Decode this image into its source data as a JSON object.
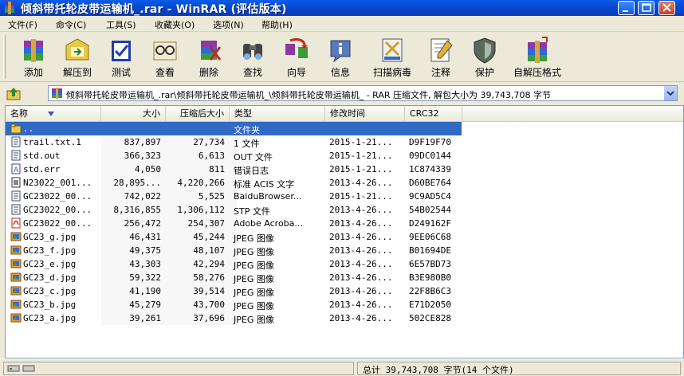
{
  "window": {
    "title": "倾斜带托轮皮带运输机_.rar - WinRAR (评估版本)"
  },
  "menu": [
    "文件(F)",
    "命令(C)",
    "工具(S)",
    "收藏夹(O)",
    "选项(N)",
    "帮助(H)"
  ],
  "toolbar": [
    {
      "label": "添加",
      "icon": "add-archive-icon"
    },
    {
      "label": "解压到",
      "icon": "extract-to-icon"
    },
    {
      "label": "测试",
      "icon": "test-icon"
    },
    {
      "label": "查看",
      "icon": "view-icon"
    },
    {
      "label": "删除",
      "icon": "delete-icon"
    },
    {
      "label": "查找",
      "icon": "find-icon"
    },
    {
      "label": "向导",
      "icon": "wizard-icon"
    },
    {
      "label": "信息",
      "icon": "info-icon"
    },
    {
      "label": "扫描病毒",
      "icon": "virus-scan-icon"
    },
    {
      "label": "注释",
      "icon": "comment-icon"
    },
    {
      "label": "保护",
      "icon": "protect-icon"
    },
    {
      "label": "自解压格式",
      "icon": "sfx-icon"
    }
  ],
  "address": {
    "path": "倾斜带托轮皮带运输机_.rar\\倾斜带托轮皮带运输机_\\倾斜带托轮皮带运输机_ - RAR 压缩文件, 解包大小为 39,743,708 字节"
  },
  "columns": {
    "name": "名称",
    "size": "大小",
    "packed": "压缩后大小",
    "type": "类型",
    "modified": "修改时间",
    "crc": "CRC32"
  },
  "files": [
    {
      "name": "..",
      "size": "",
      "packed": "",
      "type": "文件夹",
      "modified": "",
      "crc": "",
      "icon": "folder-up-icon",
      "selected": true
    },
    {
      "name": "trail.txt.1",
      "size": "837,897",
      "packed": "27,734",
      "type": "1 文件",
      "modified": "2015-1-21...",
      "crc": "D9F19F70",
      "icon": "file-icon"
    },
    {
      "name": "std.out",
      "size": "366,323",
      "packed": "6,613",
      "type": "OUT 文件",
      "modified": "2015-1-21...",
      "crc": "09DC0144",
      "icon": "file-icon"
    },
    {
      "name": "std.err",
      "size": "4,050",
      "packed": "811",
      "type": "错误日志",
      "modified": "2015-1-21...",
      "crc": "1C874339",
      "icon": "error-log-icon"
    },
    {
      "name": "N23022_001...",
      "size": "28,895...",
      "packed": "4,220,266",
      "type": "标准 ACIS 文字",
      "modified": "2013-4-26...",
      "crc": "D60BE764",
      "icon": "acis-file-icon"
    },
    {
      "name": "GC23022_00...",
      "size": "742,022",
      "packed": "5,525",
      "type": "BaiduBrowser...",
      "modified": "2015-1-21...",
      "crc": "9C9AD5C4",
      "icon": "file-icon"
    },
    {
      "name": "GC23022_00...",
      "size": "8,316,855",
      "packed": "1,306,112",
      "type": "STP 文件",
      "modified": "2013-4-26...",
      "crc": "54B02544",
      "icon": "file-icon"
    },
    {
      "name": "GC23022_00...",
      "size": "256,472",
      "packed": "254,307",
      "type": "Adobe Acroba...",
      "modified": "2013-4-26...",
      "crc": "D249162F",
      "icon": "pdf-icon"
    },
    {
      "name": "GC23_g.jpg",
      "size": "46,431",
      "packed": "45,244",
      "type": "JPEG 图像",
      "modified": "2013-4-26...",
      "crc": "9EE06C68",
      "icon": "image-icon"
    },
    {
      "name": "GC23_f.jpg",
      "size": "49,375",
      "packed": "48,107",
      "type": "JPEG 图像",
      "modified": "2013-4-26...",
      "crc": "B01694DE",
      "icon": "image-icon"
    },
    {
      "name": "GC23_e.jpg",
      "size": "43,303",
      "packed": "42,294",
      "type": "JPEG 图像",
      "modified": "2013-4-26...",
      "crc": "6E57BD73",
      "icon": "image-icon"
    },
    {
      "name": "GC23_d.jpg",
      "size": "59,322",
      "packed": "58,276",
      "type": "JPEG 图像",
      "modified": "2013-4-26...",
      "crc": "B3E980B0",
      "icon": "image-icon"
    },
    {
      "name": "GC23_c.jpg",
      "size": "41,190",
      "packed": "39,514",
      "type": "JPEG 图像",
      "modified": "2013-4-26...",
      "crc": "22F8B6C3",
      "icon": "image-icon"
    },
    {
      "name": "GC23_b.jpg",
      "size": "45,279",
      "packed": "43,700",
      "type": "JPEG 图像",
      "modified": "2013-4-26...",
      "crc": "E71D2050",
      "icon": "image-icon"
    },
    {
      "name": "GC23_a.jpg",
      "size": "39,261",
      "packed": "37,696",
      "type": "JPEG 图像",
      "modified": "2013-4-26...",
      "crc": "502CE828",
      "icon": "image-icon"
    }
  ],
  "status": {
    "total": "总计 39,743,708 字节(14 个文件)"
  },
  "colors": {
    "titlebar": "#0842c9",
    "selection": "#316ac5",
    "chrome": "#ece9d8"
  }
}
